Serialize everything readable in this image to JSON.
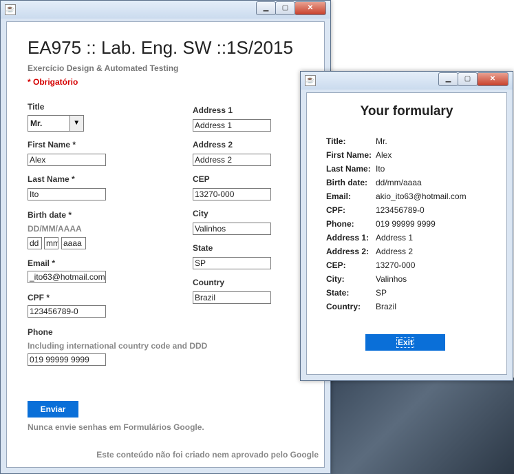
{
  "form_window": {
    "title": "EA975 :: Lab. Eng. SW ::1S/2015",
    "subtitle": "Exercício Design & Automated Testing",
    "required_note": "* Obrigatório",
    "title_label": "Title",
    "title_value": "Mr.",
    "first_name_label": "First Name *",
    "first_name_value": "Alex",
    "last_name_label": "Last Name *",
    "last_name_value": "Ito",
    "birth_label": "Birth date *",
    "birth_format": "DD/MM/AAAA",
    "birth_dd": "dd",
    "birth_mm": "mm",
    "birth_yyyy": "aaaa",
    "email_label": "Email *",
    "email_value": "_ito63@hotmail.com",
    "cpf_label": "CPF *",
    "cpf_value": "123456789-0",
    "phone_label": "Phone",
    "phone_hint": "Including international country code and DDD",
    "phone_value": "019 99999 9999",
    "address1_label": "Address 1",
    "address1_value": "Address 1",
    "address2_label": "Address 2",
    "address2_value": "Address 2",
    "cep_label": "CEP",
    "cep_value": "13270-000",
    "city_label": "City",
    "city_value": "Valinhos",
    "state_label": "State",
    "state_value": "SP",
    "country_label": "Country",
    "country_value": "Brazil",
    "submit_label": "Enviar",
    "footer_note": "Nunca envie senhas em Formulários Google.",
    "footer_disclaimer": "Este conteúdo não foi criado nem aprovado pelo Google"
  },
  "result_window": {
    "heading": "Your formulary",
    "rows": [
      {
        "key": "Title:",
        "value": "Mr."
      },
      {
        "key": "First Name:",
        "value": "Alex"
      },
      {
        "key": "Last Name:",
        "value": "Ito"
      },
      {
        "key": "Birth date:",
        "value": "dd/mm/aaaa"
      },
      {
        "key": "Email:",
        "value": "akio_ito63@hotmail.com"
      },
      {
        "key": "CPF:",
        "value": "123456789-0"
      },
      {
        "key": "Phone:",
        "value": "019 99999 9999"
      },
      {
        "key": "Address 1:",
        "value": "Address 1"
      },
      {
        "key": "Address 2:",
        "value": "Address 2"
      },
      {
        "key": "CEP:",
        "value": "13270-000"
      },
      {
        "key": "City:",
        "value": "Valinhos"
      },
      {
        "key": "State:",
        "value": "SP"
      },
      {
        "key": "Country:",
        "value": "Brazil"
      }
    ],
    "exit_label": "Exit"
  },
  "colors": {
    "accent_button": "#0a6fd8",
    "required_red": "#d40000",
    "window_frame": "#dbe6f3"
  }
}
